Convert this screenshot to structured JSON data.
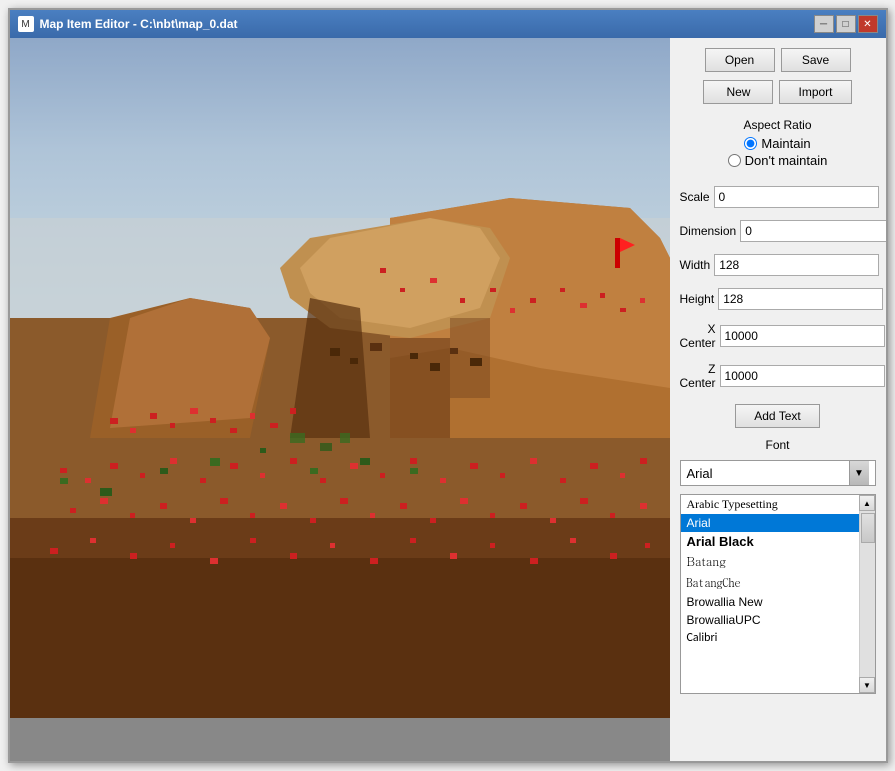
{
  "window": {
    "title": "Map Item Editor - C:\\nbt\\map_0.dat",
    "icon": "M"
  },
  "title_buttons": {
    "minimize": "─",
    "maximize": "□",
    "close": "✕"
  },
  "buttons": {
    "open": "Open",
    "save": "Save",
    "new": "New",
    "import": "Import",
    "add_text": "Add Text"
  },
  "aspect_ratio": {
    "title": "Aspect Ratio",
    "maintain": "Maintain",
    "dont_maintain": "Don't maintain",
    "selected": "maintain"
  },
  "fields": {
    "scale": {
      "label": "Scale",
      "value": "0"
    },
    "dimension": {
      "label": "Dimension",
      "value": "0"
    },
    "width": {
      "label": "Width",
      "value": "128"
    },
    "height": {
      "label": "Height",
      "value": "128"
    },
    "x_center": {
      "label": "X Center",
      "value": "10000"
    },
    "z_center": {
      "label": "Z Center",
      "value": "10000"
    }
  },
  "font": {
    "label": "Font",
    "selected": "Arial",
    "list": [
      {
        "name": "Arabic Typesetting",
        "class": "arabic"
      },
      {
        "name": "Arial",
        "class": "arial",
        "selected": true
      },
      {
        "name": "Arial Black",
        "class": "arial-black"
      },
      {
        "name": "Batang",
        "class": "batang"
      },
      {
        "name": "BatangChe",
        "class": "batangche"
      },
      {
        "name": "Browallia New",
        "class": "browallia"
      },
      {
        "name": "BrowalliaUPC",
        "class": "browalliaUPC"
      },
      {
        "name": "Calibri",
        "class": "calibri"
      }
    ]
  }
}
